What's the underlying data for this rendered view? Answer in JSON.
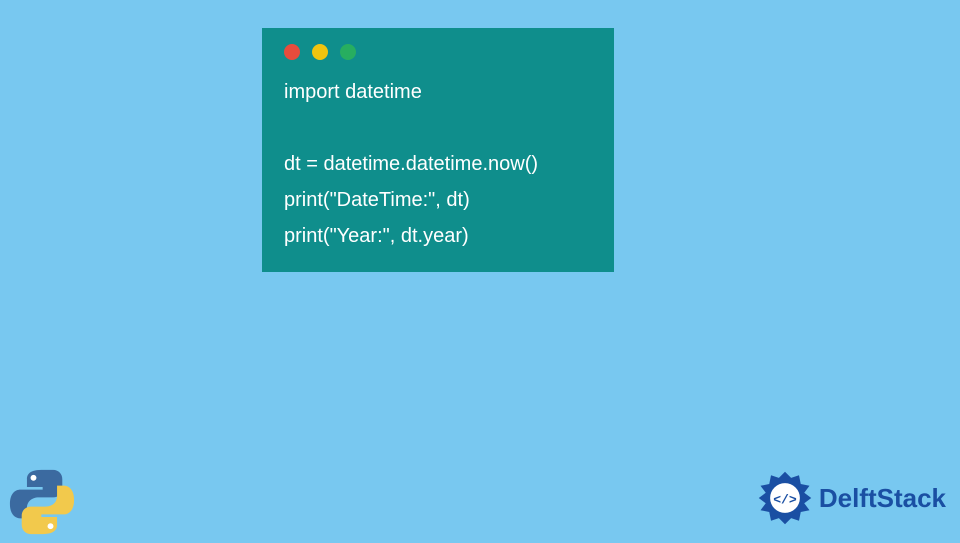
{
  "window": {
    "dots": {
      "red": "#e74c3c",
      "yellow": "#f1c40f",
      "green": "#27ae60"
    }
  },
  "code": {
    "line1": "import datetime",
    "line2": "",
    "line3": "dt = datetime.datetime.now()",
    "line4": "print(\"DateTime:\", dt)",
    "line5": "print(\"Year:\", dt.year)"
  },
  "icons": {
    "python": "python-logo",
    "brand_badge": "delftstack-badge"
  },
  "brand": {
    "name": "DelftStack"
  },
  "colors": {
    "background": "#78c8f0",
    "window_bg": "#0f8e8c",
    "code_text": "#ffffff",
    "brand_text": "#1a4fa3"
  }
}
